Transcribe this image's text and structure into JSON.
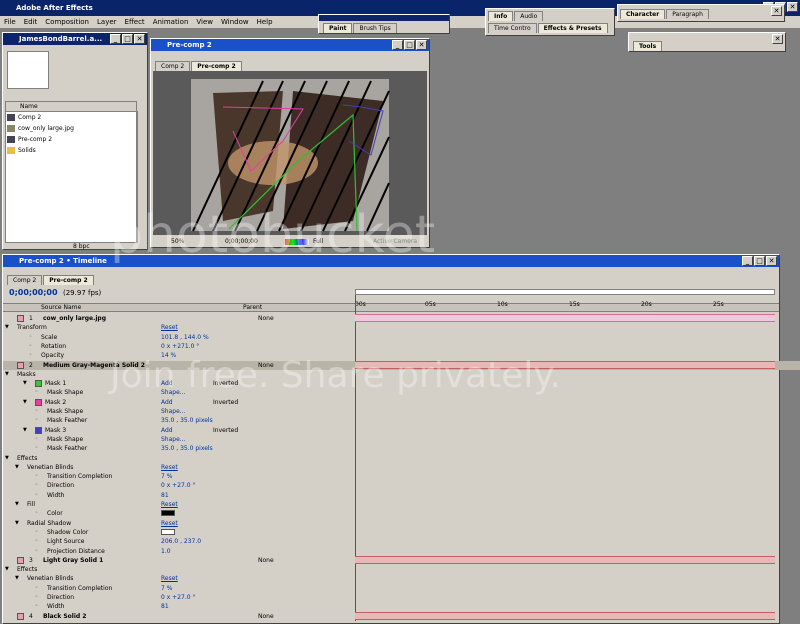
{
  "app_title": "Adobe After Effects",
  "menu": [
    "File",
    "Edit",
    "Composition",
    "Layer",
    "Effect",
    "Animation",
    "View",
    "Window",
    "Help"
  ],
  "palettes": {
    "paint_tabs": [
      "Paint",
      "Brush Tips"
    ],
    "info_tabs": [
      "Info",
      "Audio"
    ],
    "time_effects_tabs": [
      "Time Contro",
      "Effects & Presets"
    ],
    "char_tabs": [
      "Character",
      "Paragraph"
    ],
    "tools_title": "Tools"
  },
  "project": {
    "title": "JamesBondBarrel.a...",
    "col_name": "Name",
    "items": [
      "Comp 2",
      "cow_only large.jpg",
      "Pre-comp 2",
      "Solids"
    ],
    "footer": "8 bpc"
  },
  "comp": {
    "title": "Pre-comp 2",
    "tabs": [
      "Comp 2",
      "Pre-comp 2"
    ],
    "zoom": "50%",
    "timecode": "0;00;00;00",
    "resolution": "Full",
    "camera": "Active Camera"
  },
  "timeline": {
    "title": "Pre-comp 2 • Timeline",
    "tabs": [
      "Comp 2",
      "Pre-comp 2"
    ],
    "timecode": "0;00;00;00",
    "fps": "(29.97 fps)",
    "col_source": "Source Name",
    "col_parent": "Parent",
    "ruler": [
      "00s",
      "05s",
      "10s",
      "15s",
      "20s",
      "25s"
    ],
    "rows": [
      {
        "num": "1",
        "label": "cow_only large.jpg",
        "value": "",
        "parent": "None",
        "kind": "layer",
        "color": "#e8a0b0"
      },
      {
        "label": "Transform",
        "value": "Reset",
        "kind": "group"
      },
      {
        "label": "Scale",
        "value": "101.8 , 144.0 %",
        "kind": "prop"
      },
      {
        "label": "Rotation",
        "value": "0 x +271.0 °",
        "kind": "prop"
      },
      {
        "label": "Opacity",
        "value": "14 %",
        "kind": "prop"
      },
      {
        "num": "2",
        "label": "Medium Gray-Magenta Solid 2",
        "value": "",
        "parent": "None",
        "kind": "layer-sel",
        "color": "#e8a0b0"
      },
      {
        "label": "Masks",
        "value": "",
        "kind": "group"
      },
      {
        "label": "Mask 1",
        "value": "Add",
        "extra": "Inverted",
        "kind": "mask",
        "color": "#40c040"
      },
      {
        "label": "Mask Shape",
        "value": "Shape...",
        "kind": "prop2"
      },
      {
        "label": "Mask 2",
        "value": "Add",
        "extra": "Inverted",
        "kind": "mask",
        "color": "#e040a0"
      },
      {
        "label": "Mask Shape",
        "value": "Shape...",
        "kind": "prop2"
      },
      {
        "label": "Mask Feather",
        "value": "35.0 , 35.0 pixels",
        "kind": "prop2"
      },
      {
        "label": "Mask 3",
        "value": "Add",
        "extra": "Inverted",
        "kind": "mask",
        "color": "#4040c0"
      },
      {
        "label": "Mask Shape",
        "value": "Shape...",
        "kind": "prop2"
      },
      {
        "label": "Mask Feather",
        "value": "35.0 , 35.0 pixels",
        "kind": "prop2"
      },
      {
        "label": "Effects",
        "value": "",
        "kind": "group"
      },
      {
        "label": "Venetian Blinds",
        "value": "Reset",
        "kind": "effect"
      },
      {
        "label": "Transition Completion",
        "value": "7 %",
        "kind": "prop2"
      },
      {
        "label": "Direction",
        "value": "0 x +27.0 °",
        "kind": "prop2"
      },
      {
        "label": "Width",
        "value": "81",
        "kind": "prop2"
      },
      {
        "label": "Fill",
        "value": "Reset",
        "kind": "effect"
      },
      {
        "label": "Color",
        "value": "",
        "kind": "prop2"
      },
      {
        "label": "Radial Shadow",
        "value": "Reset",
        "kind": "effect"
      },
      {
        "label": "Shadow Color",
        "value": "",
        "kind": "prop2"
      },
      {
        "label": "Light Source",
        "value": "206.0 , 237.0",
        "kind": "prop2"
      },
      {
        "label": "Projection Distance",
        "value": "1.0",
        "kind": "prop2"
      },
      {
        "num": "3",
        "label": "Light Gray Solid 1",
        "value": "",
        "parent": "None",
        "kind": "layer",
        "color": "#e8a0b0"
      },
      {
        "label": "Effects",
        "value": "",
        "kind": "group"
      },
      {
        "label": "Venetian Blinds",
        "value": "Reset",
        "kind": "effect"
      },
      {
        "label": "Transition Completion",
        "value": "7 %",
        "kind": "prop2"
      },
      {
        "label": "Direction",
        "value": "0 x +27.0 °",
        "kind": "prop2"
      },
      {
        "label": "Width",
        "value": "81",
        "kind": "prop2"
      },
      {
        "num": "4",
        "label": "Black Solid 2",
        "value": "",
        "parent": "None",
        "kind": "layer",
        "color": "#e8a0b0"
      }
    ]
  },
  "watermark": {
    "brand": "photobucket",
    "tagline": "Join free. Share privately."
  }
}
